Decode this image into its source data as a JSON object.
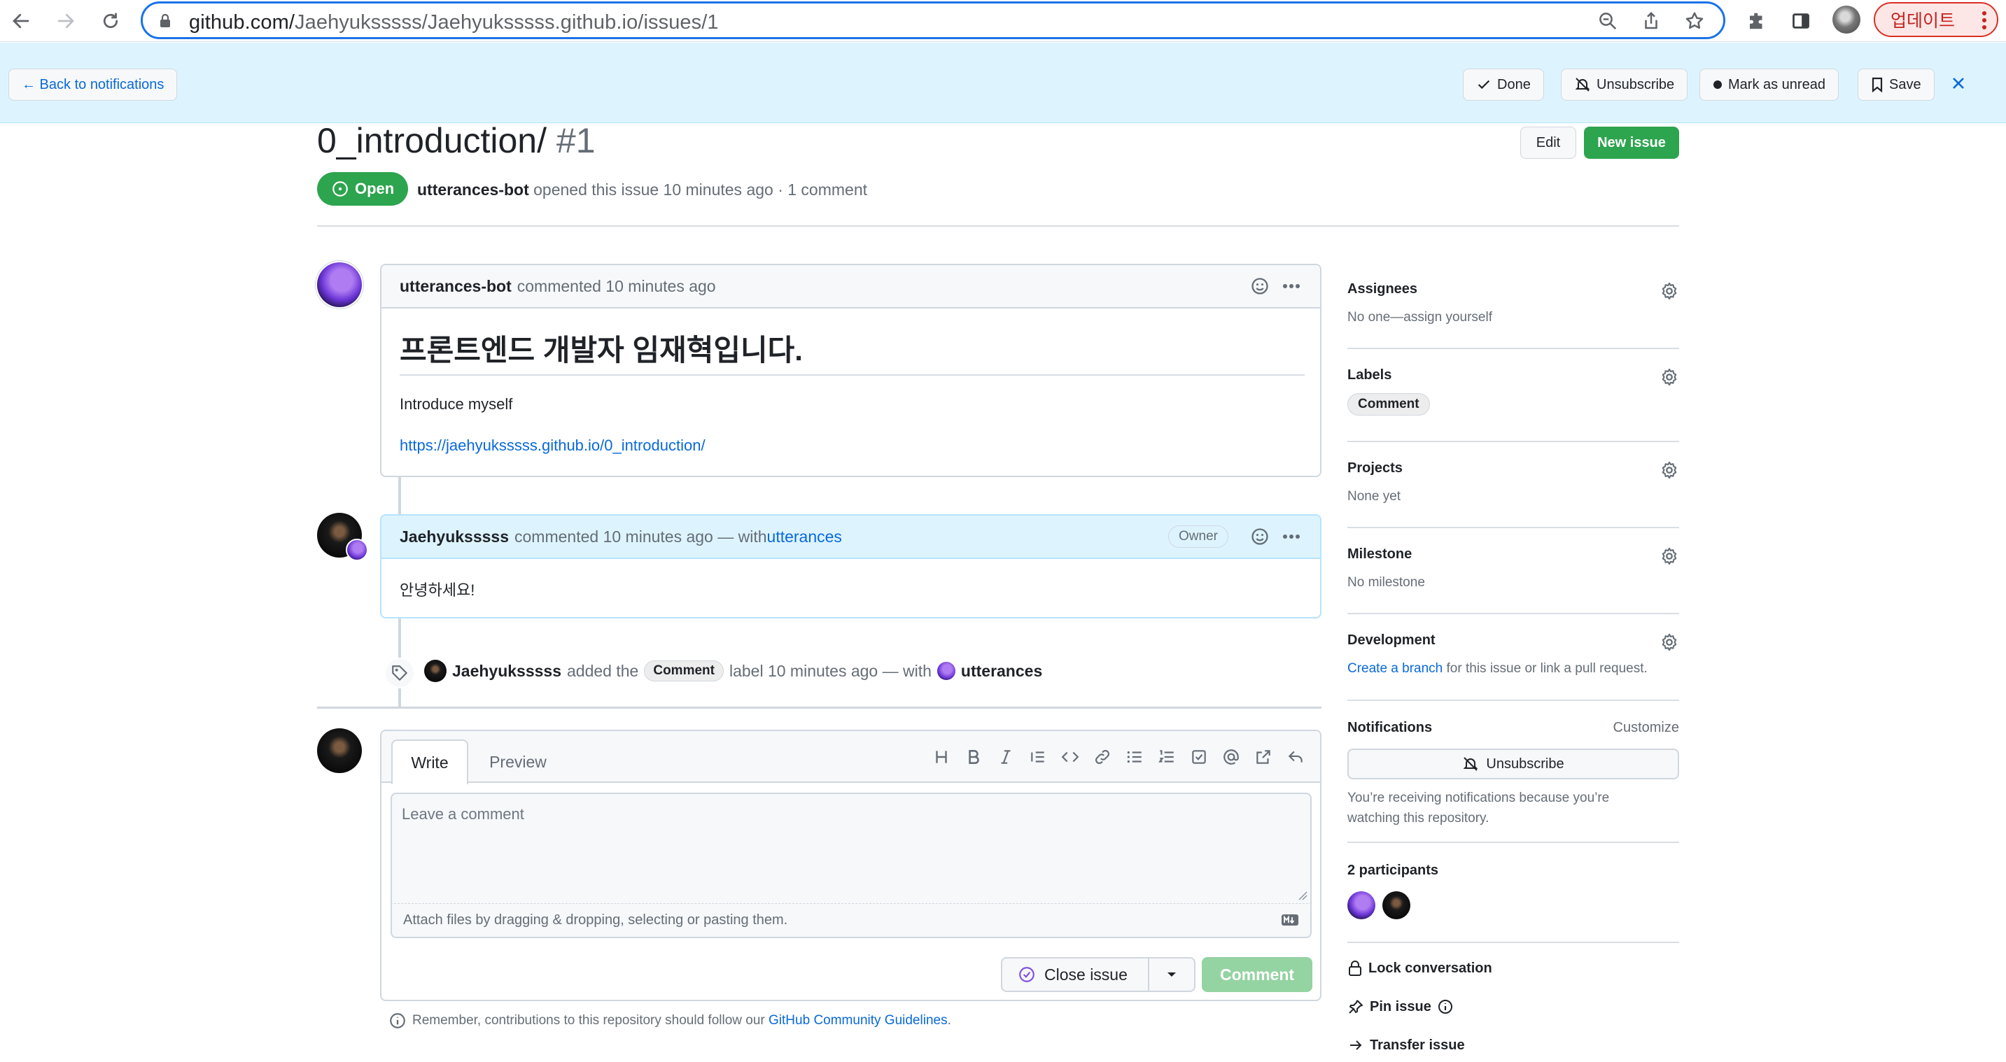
{
  "browser": {
    "url_host": "github.com/",
    "url_path": "Jaehyuksssss/Jaehyuksssss.github.io/issues/1",
    "update_label": "업데이트",
    "accent": "#1a73e8"
  },
  "notification_bar": {
    "back_label": "← Back to notifications",
    "done_label": "Done",
    "unsubscribe_label": "Unsubscribe",
    "mark_unread_label": "Mark as unread",
    "save_label": "Save"
  },
  "issue": {
    "title": "0_introduction/",
    "number": "#1",
    "edit_label": "Edit",
    "new_issue_label": "New issue",
    "state": "Open",
    "author": "utterances-bot",
    "meta_text": " opened this issue 10 minutes ago · 1 comment"
  },
  "comments": [
    {
      "author": "utterances-bot",
      "meta": "commented 10 minutes ago",
      "heading": "프론트엔드 개발자 임재혁입니다.",
      "paragraph": "Introduce myself",
      "link": "https://jaehyuksssss.github.io/0_introduction/"
    },
    {
      "author": "Jaehyuksssss",
      "meta": "commented 10 minutes ago — with ",
      "via": "utterances",
      "badge": "Owner",
      "body": "안녕하세요!"
    }
  ],
  "label_event": {
    "actor": "Jaehyuksssss",
    "action": "added the",
    "label": "Comment",
    "suffix": "label 10 minutes ago — with",
    "via": "utterances"
  },
  "composer": {
    "tab_write": "Write",
    "tab_preview": "Preview",
    "placeholder": "Leave a comment",
    "attach_text": "Attach files by dragging & dropping, selecting or pasting them.",
    "close_issue_label": "Close issue",
    "comment_label": "Comment",
    "guideline_prefix": "Remember, contributions to this repository should follow our ",
    "guideline_link": "GitHub Community Guidelines",
    "guideline_suffix": "."
  },
  "sidebar": {
    "assignees_title": "Assignees",
    "assignees_value": "No one—assign yourself",
    "labels_title": "Labels",
    "labels_value": "Comment",
    "projects_title": "Projects",
    "projects_value": "None yet",
    "milestone_title": "Milestone",
    "milestone_value": "No milestone",
    "development_title": "Development",
    "development_link": "Create a branch",
    "development_text": " for this issue or link a pull request.",
    "notifications_title": "Notifications",
    "customize_label": "Customize",
    "unsubscribe_label": "Unsubscribe",
    "notifications_text_1": "You’re receiving notifications because you’re",
    "notifications_text_2": "watching this repository.",
    "participants_title": "2 participants",
    "lock_label": "Lock conversation",
    "pin_label": "Pin issue",
    "transfer_label": "Transfer issue"
  }
}
